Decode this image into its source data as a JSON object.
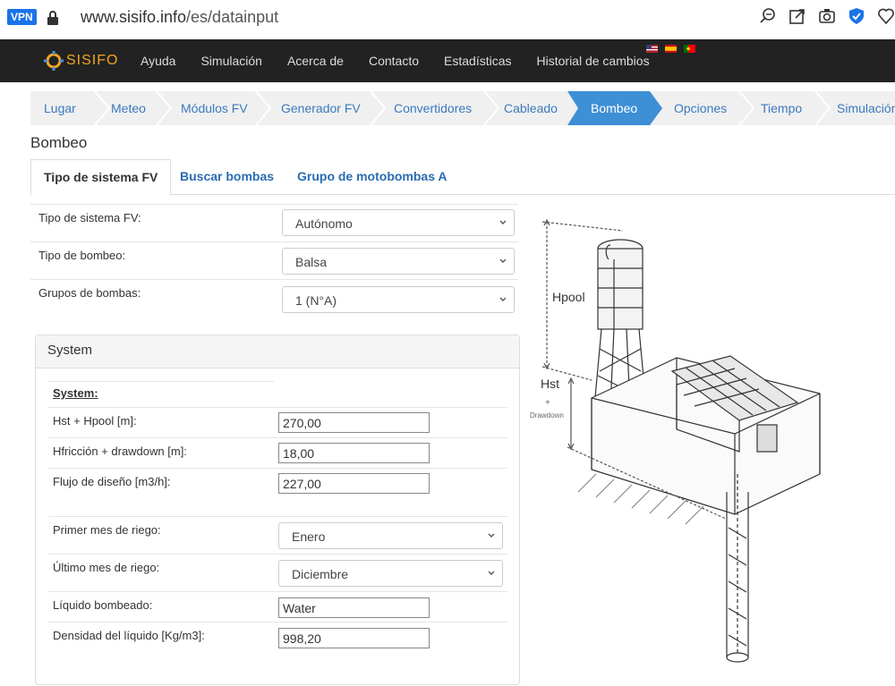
{
  "browser": {
    "vpn_badge": "VPN",
    "url_host": "www.sisifo.info",
    "url_path": "/es/datainput"
  },
  "app": {
    "logo_text": "SISIFO",
    "nav": [
      "Ayuda",
      "Simulación",
      "Acerca de",
      "Contacto",
      "Estadísticas",
      "Historial de cambios"
    ]
  },
  "steps": [
    "Lugar",
    "Meteo",
    "Módulos FV",
    "Generador FV",
    "Convertidores",
    "Cableado",
    "Bombeo",
    "Opciones",
    "Tiempo",
    "Simulación"
  ],
  "active_step": "Bombeo",
  "page_title": "Bombeo",
  "tabs": [
    "Tipo de sistema FV",
    "Buscar bombas",
    "Grupo de motobombas A"
  ],
  "form": {
    "tipo_sistema": {
      "label": "Tipo de sistema FV:",
      "value": "Autónomo"
    },
    "tipo_bombeo": {
      "label": "Tipo de bombeo:",
      "value": "Balsa"
    },
    "grupos": {
      "label": "Grupos de bombas:",
      "value": "1 (N°A)"
    }
  },
  "panel": {
    "title": "System",
    "section_header": "System:",
    "hst_hpool": {
      "label": "Hst + Hpool [m]:",
      "value": "270,00"
    },
    "hfriccion": {
      "label": "Hfricción + drawdown [m]:",
      "value": "18,00"
    },
    "flujo": {
      "label": "Flujo de diseño [m3/h]:",
      "value": "227,00"
    },
    "primer_mes": {
      "label": "Primer mes de riego:",
      "value": "Enero"
    },
    "ultimo_mes": {
      "label": "Último mes de riego:",
      "value": "Diciembre"
    },
    "liquido": {
      "label": "Líquido bombeado:",
      "value": "Water"
    },
    "densidad": {
      "label": "Densidad del líquido [Kg/m3]:",
      "value": "998,20"
    }
  },
  "illustration": {
    "hpool_label": "Hpool",
    "hst_label": "Hst",
    "plus": "+",
    "drawdown": "Drawdown"
  },
  "colors": {
    "accent": "#3d8fd6",
    "navbar": "#222222",
    "logo": "#f5a623",
    "link": "#2a6cb0"
  }
}
